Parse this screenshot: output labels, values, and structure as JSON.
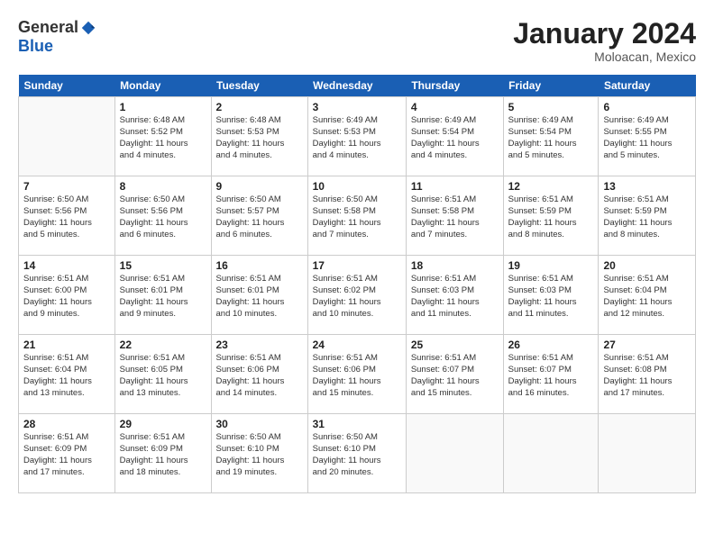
{
  "header": {
    "logo_general": "General",
    "logo_blue": "Blue",
    "title": "January 2024",
    "location": "Moloacan, Mexico"
  },
  "weekdays": [
    "Sunday",
    "Monday",
    "Tuesday",
    "Wednesday",
    "Thursday",
    "Friday",
    "Saturday"
  ],
  "weeks": [
    [
      {
        "day": "",
        "info": ""
      },
      {
        "day": "1",
        "info": "Sunrise: 6:48 AM\nSunset: 5:52 PM\nDaylight: 11 hours\nand 4 minutes."
      },
      {
        "day": "2",
        "info": "Sunrise: 6:48 AM\nSunset: 5:53 PM\nDaylight: 11 hours\nand 4 minutes."
      },
      {
        "day": "3",
        "info": "Sunrise: 6:49 AM\nSunset: 5:53 PM\nDaylight: 11 hours\nand 4 minutes."
      },
      {
        "day": "4",
        "info": "Sunrise: 6:49 AM\nSunset: 5:54 PM\nDaylight: 11 hours\nand 4 minutes."
      },
      {
        "day": "5",
        "info": "Sunrise: 6:49 AM\nSunset: 5:54 PM\nDaylight: 11 hours\nand 5 minutes."
      },
      {
        "day": "6",
        "info": "Sunrise: 6:49 AM\nSunset: 5:55 PM\nDaylight: 11 hours\nand 5 minutes."
      }
    ],
    [
      {
        "day": "7",
        "info": "Sunrise: 6:50 AM\nSunset: 5:56 PM\nDaylight: 11 hours\nand 5 minutes."
      },
      {
        "day": "8",
        "info": "Sunrise: 6:50 AM\nSunset: 5:56 PM\nDaylight: 11 hours\nand 6 minutes."
      },
      {
        "day": "9",
        "info": "Sunrise: 6:50 AM\nSunset: 5:57 PM\nDaylight: 11 hours\nand 6 minutes."
      },
      {
        "day": "10",
        "info": "Sunrise: 6:50 AM\nSunset: 5:58 PM\nDaylight: 11 hours\nand 7 minutes."
      },
      {
        "day": "11",
        "info": "Sunrise: 6:51 AM\nSunset: 5:58 PM\nDaylight: 11 hours\nand 7 minutes."
      },
      {
        "day": "12",
        "info": "Sunrise: 6:51 AM\nSunset: 5:59 PM\nDaylight: 11 hours\nand 8 minutes."
      },
      {
        "day": "13",
        "info": "Sunrise: 6:51 AM\nSunset: 5:59 PM\nDaylight: 11 hours\nand 8 minutes."
      }
    ],
    [
      {
        "day": "14",
        "info": "Sunrise: 6:51 AM\nSunset: 6:00 PM\nDaylight: 11 hours\nand 9 minutes."
      },
      {
        "day": "15",
        "info": "Sunrise: 6:51 AM\nSunset: 6:01 PM\nDaylight: 11 hours\nand 9 minutes."
      },
      {
        "day": "16",
        "info": "Sunrise: 6:51 AM\nSunset: 6:01 PM\nDaylight: 11 hours\nand 10 minutes."
      },
      {
        "day": "17",
        "info": "Sunrise: 6:51 AM\nSunset: 6:02 PM\nDaylight: 11 hours\nand 10 minutes."
      },
      {
        "day": "18",
        "info": "Sunrise: 6:51 AM\nSunset: 6:03 PM\nDaylight: 11 hours\nand 11 minutes."
      },
      {
        "day": "19",
        "info": "Sunrise: 6:51 AM\nSunset: 6:03 PM\nDaylight: 11 hours\nand 11 minutes."
      },
      {
        "day": "20",
        "info": "Sunrise: 6:51 AM\nSunset: 6:04 PM\nDaylight: 11 hours\nand 12 minutes."
      }
    ],
    [
      {
        "day": "21",
        "info": "Sunrise: 6:51 AM\nSunset: 6:04 PM\nDaylight: 11 hours\nand 13 minutes."
      },
      {
        "day": "22",
        "info": "Sunrise: 6:51 AM\nSunset: 6:05 PM\nDaylight: 11 hours\nand 13 minutes."
      },
      {
        "day": "23",
        "info": "Sunrise: 6:51 AM\nSunset: 6:06 PM\nDaylight: 11 hours\nand 14 minutes."
      },
      {
        "day": "24",
        "info": "Sunrise: 6:51 AM\nSunset: 6:06 PM\nDaylight: 11 hours\nand 15 minutes."
      },
      {
        "day": "25",
        "info": "Sunrise: 6:51 AM\nSunset: 6:07 PM\nDaylight: 11 hours\nand 15 minutes."
      },
      {
        "day": "26",
        "info": "Sunrise: 6:51 AM\nSunset: 6:07 PM\nDaylight: 11 hours\nand 16 minutes."
      },
      {
        "day": "27",
        "info": "Sunrise: 6:51 AM\nSunset: 6:08 PM\nDaylight: 11 hours\nand 17 minutes."
      }
    ],
    [
      {
        "day": "28",
        "info": "Sunrise: 6:51 AM\nSunset: 6:09 PM\nDaylight: 11 hours\nand 17 minutes."
      },
      {
        "day": "29",
        "info": "Sunrise: 6:51 AM\nSunset: 6:09 PM\nDaylight: 11 hours\nand 18 minutes."
      },
      {
        "day": "30",
        "info": "Sunrise: 6:50 AM\nSunset: 6:10 PM\nDaylight: 11 hours\nand 19 minutes."
      },
      {
        "day": "31",
        "info": "Sunrise: 6:50 AM\nSunset: 6:10 PM\nDaylight: 11 hours\nand 20 minutes."
      },
      {
        "day": "",
        "info": ""
      },
      {
        "day": "",
        "info": ""
      },
      {
        "day": "",
        "info": ""
      }
    ]
  ]
}
